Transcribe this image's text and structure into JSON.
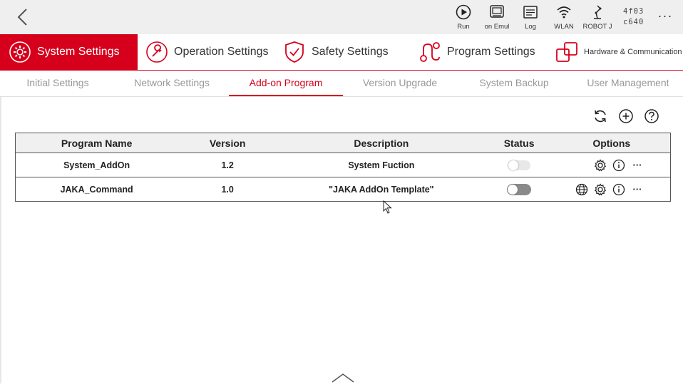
{
  "topbar": {
    "tools": [
      {
        "label": "Run",
        "icon": "play-icon"
      },
      {
        "label": "on Emul",
        "icon": "emulation-icon"
      },
      {
        "label": "Log",
        "icon": "log-icon"
      },
      {
        "label": "WLAN",
        "icon": "wifi-icon"
      },
      {
        "label": "ROBOT J",
        "icon": "robot-arm-icon"
      }
    ],
    "id_line1": "4f03",
    "id_line2": "c640",
    "more_label": "···"
  },
  "main_tabs": [
    {
      "label": "System Settings",
      "icon": "gear-icon",
      "active": true
    },
    {
      "label": "Operation Settings",
      "icon": "wrench-icon",
      "active": false
    },
    {
      "label": "Safety Settings",
      "icon": "shield-icon",
      "active": false
    },
    {
      "label": "Program Settings",
      "icon": "program-icon",
      "active": false
    },
    {
      "label": "Hardware & Communication",
      "icon": "hardware-icon",
      "active": false
    }
  ],
  "sub_tabs": [
    {
      "label": "Initial Settings",
      "active": false
    },
    {
      "label": "Network Settings",
      "active": false
    },
    {
      "label": "Add-on Program",
      "active": true
    },
    {
      "label": "Version Upgrade",
      "active": false
    },
    {
      "label": "System Backup",
      "active": false
    },
    {
      "label": "User Management",
      "active": false
    }
  ],
  "table": {
    "headers": [
      "Program Name",
      "Version",
      "Description",
      "Status",
      "Options"
    ],
    "rows": [
      {
        "name": "System_AddOn",
        "version": "1.2",
        "description": "System Fuction",
        "status_on": false
      },
      {
        "name": "JAKA_Command",
        "version": "1.0",
        "description": "\"JAKA AddOn Template\"",
        "status_on": false
      }
    ]
  },
  "colors": {
    "accent": "#d6001c",
    "inactive_text": "#999999",
    "topbar_bg": "#efefef"
  }
}
